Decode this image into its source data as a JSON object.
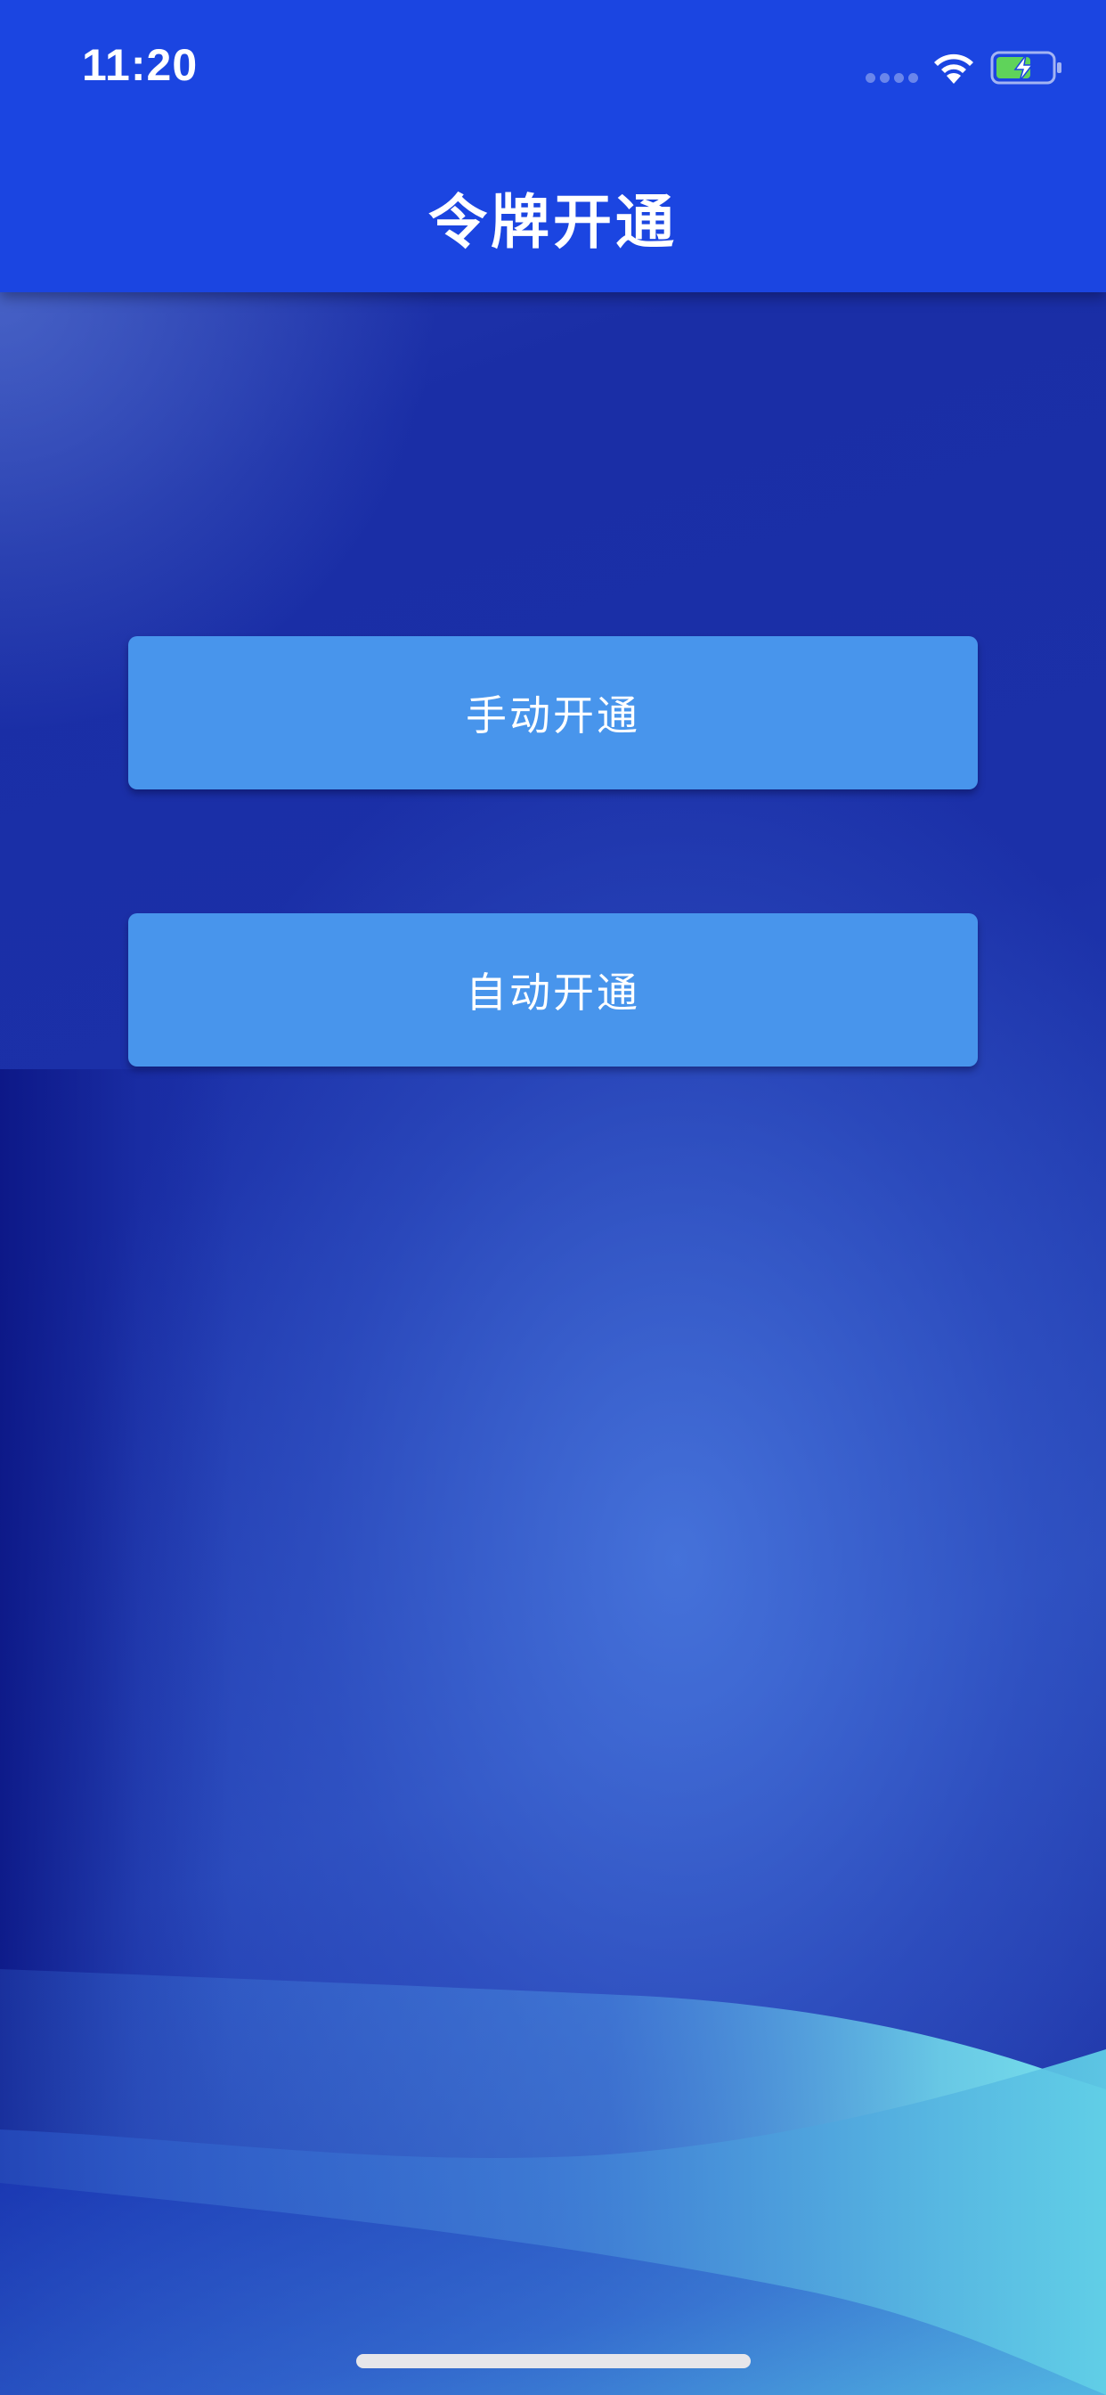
{
  "status_bar": {
    "time": "11:20",
    "icons": [
      "signal-dots-icon",
      "wifi-icon",
      "battery-charging-icon"
    ]
  },
  "navbar": {
    "title": "令牌开通"
  },
  "actions": {
    "manual_label": "手动开通",
    "auto_label": "自动开通"
  },
  "colors": {
    "navbar": "#1b45e1",
    "button": "#4895ec",
    "battery_fill": "#5fd35a",
    "wave_light": "#6fe0ea"
  }
}
